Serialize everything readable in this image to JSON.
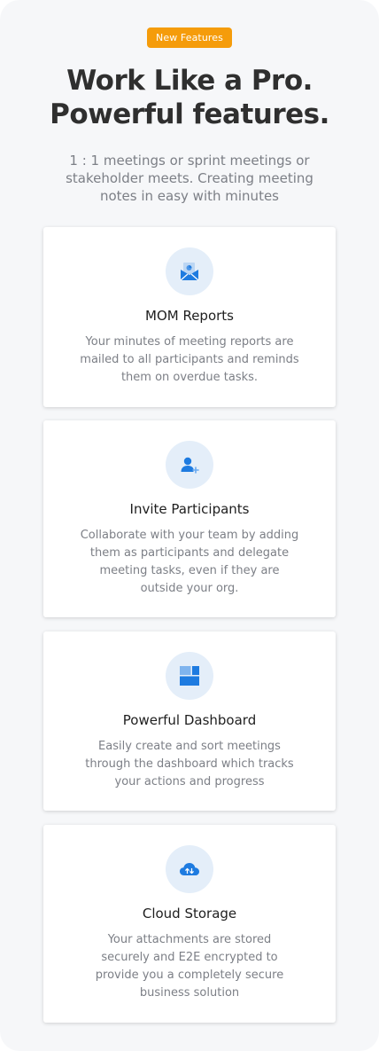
{
  "badge": "New Features",
  "hero": {
    "title_lines": [
      "Work Like a Pro.",
      "Powerful features."
    ],
    "subtitle_lines": [
      "1 : 1 meetings or sprint meetings or",
      "stakeholder meets. Creating meeting",
      "notes in easy with minutes"
    ]
  },
  "colors": {
    "badge_bg": "#f59c0b",
    "icon_bg": "#e4eef9",
    "icon_blue": "#1e7be0"
  },
  "features": [
    {
      "icon": "mail-report-icon",
      "title": "MOM Reports",
      "desc_lines": [
        "Your minutes of meeting reports are",
        "mailed to all participants and reminds",
        "them on overdue tasks."
      ]
    },
    {
      "icon": "add-user-icon",
      "title": "Invite Participants",
      "desc_lines": [
        "Collaborate with your team by adding",
        "them as participants and delegate",
        "meeting tasks, even if they are",
        "outside your org."
      ]
    },
    {
      "icon": "dashboard-icon",
      "title": "Powerful Dashboard",
      "desc_lines": [
        "Easily create and sort meetings",
        "through the dashboard which tracks",
        "your actions and progress"
      ]
    },
    {
      "icon": "cloud-sync-icon",
      "title": "Cloud Storage",
      "desc_lines": [
        "Your attachments are stored",
        "securely and E2E encrypted to",
        "provide you a completely secure",
        "business solution"
      ]
    }
  ]
}
